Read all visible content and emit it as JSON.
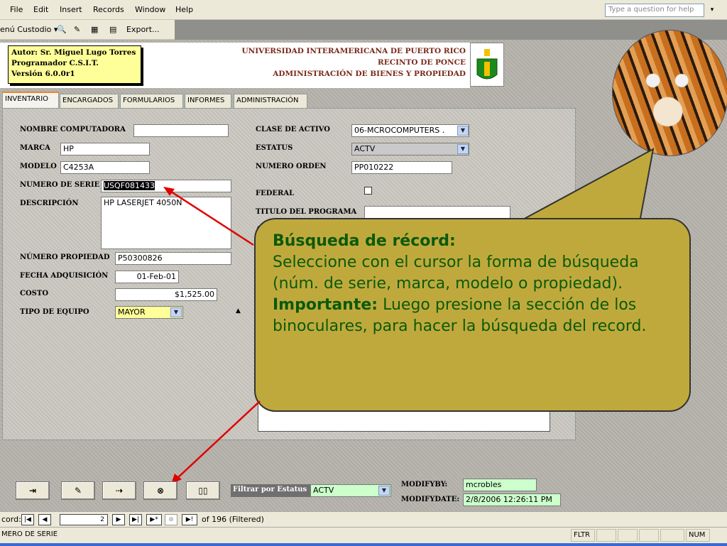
{
  "menu": {
    "items": [
      "File",
      "Edit",
      "Insert",
      "Records",
      "Window",
      "Help"
    ],
    "help_placeholder": "Type a question for help"
  },
  "toolbar": {
    "custodio": "enú Custodio ▾",
    "export": "Export..."
  },
  "header": {
    "author": "Autor: Sr. Miguel Lugo Torres",
    "programmer": "Programador C.S.I.T.",
    "version": "Versión 6.0.0r1",
    "uni_line1": "UNIVERSIDAD INTERAMERICANA DE PUERTO RICO",
    "uni_line2": "RECINTO DE PONCE",
    "uni_line3": "ADMINISTRACIÓN DE BIENES Y PROPIEDAD"
  },
  "tabs": [
    "INVENTARIO",
    "ENCARGADOS",
    "FORMULARIOS",
    "INFORMES",
    "ADMINISTRACIÓN"
  ],
  "form": {
    "labels": {
      "nombre": "NOMBRE COMPUTADORA",
      "marca": "MARCA",
      "modelo": "MODELO",
      "serie": "NUMERO DE SERIE",
      "descripcion": "DESCRIPCIÓN",
      "propiedad": "NÚMERO PROPIEDAD",
      "fecha": "FECHA ADQUISICIÓN",
      "costo": "COSTO",
      "tipo": "TIPO DE EQUIPO",
      "clase": "CLASE DE ACTIVO",
      "estatus": "ESTATUS",
      "orden": "NUMERO ORDEN",
      "federal": "FEDERAL",
      "titulo": "TITULO DEL PROGRAMA"
    },
    "values": {
      "nombre": "",
      "marca": "HP",
      "modelo": "C4253A",
      "serie": "USQF081433",
      "descripcion": "HP LASERJET 4050N",
      "propiedad": "P50300826",
      "fecha": "01-Feb-01",
      "costo": "$1,525.00",
      "tipo": "MAYOR",
      "clase": "06-MCROCOMPUTERS .",
      "estatus": "ACTV",
      "orden": "PP010222",
      "titulo": ""
    }
  },
  "callout": {
    "heading": "Búsqueda de récord:",
    "body": "Seleccione con el cursor la forma de búsqueda (núm. de serie, marca, modelo o propiedad).",
    "important_label": "Importante:",
    "important_text": "Luego presione la sección de los binoculares, para hacer la búsqueda del record."
  },
  "bottom": {
    "filtrar_label": "Filtrar por Estatus",
    "filtrar_value": "ACTV",
    "modifyby_label": "MODIFYBY:",
    "modifyby_value": "mcrobles",
    "modifydate_label": "MODIFYDATE:",
    "modifydate_value": "2/8/2006 12:26:11 PM"
  },
  "record_nav": {
    "label": "cord:",
    "current": "2",
    "total": "of 196 (Filtered)"
  },
  "status": {
    "field": "MERO DE SERIE",
    "fltr": "FLTR",
    "num": "NUM"
  },
  "colors": {
    "callout_bg": "#c0a93c",
    "callout_text": "#0a5a0a",
    "arrow": "#e00000"
  }
}
